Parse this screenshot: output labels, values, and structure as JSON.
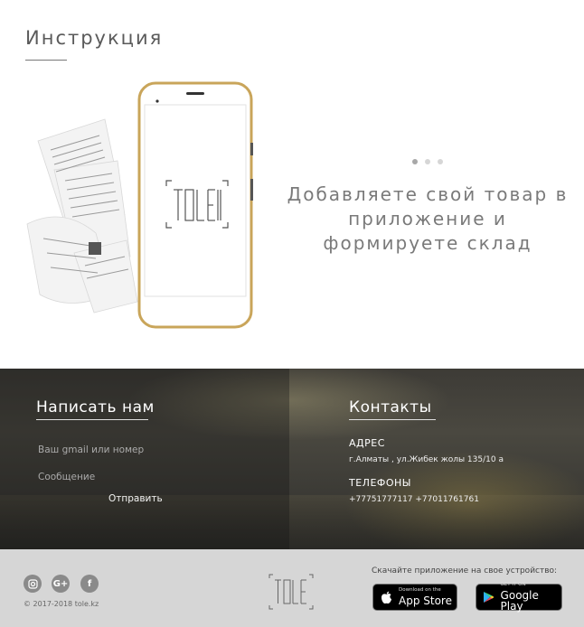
{
  "instructions": {
    "title": "Инструкция",
    "slide_text": "Добавляете свой товар в приложение и формируете склад",
    "dots": {
      "count": 3,
      "active_index": 0
    },
    "logo_text": "TOLE"
  },
  "contact_form": {
    "heading": "Написать нам",
    "email_placeholder": "Ваш gmail или номер",
    "message_placeholder": "Сообщение",
    "send_label": "Отправить"
  },
  "contacts": {
    "heading": "Контакты",
    "address_label": "АДРЕС",
    "address_value": "г.Алматы , ул.Жибек жолы 135/10 а",
    "phones_label": "ТЕЛЕФОНЫ",
    "phones_value": "+77751777117 +77011761761"
  },
  "footer": {
    "social_icons": [
      "instagram-icon",
      "google-plus-icon",
      "facebook-icon"
    ],
    "copyright": "© 2017-2018 tole.kz",
    "logo_text": "TOLE",
    "download_text": "Скачайте приложение на свое устройство:",
    "app_store": {
      "small": "Download on the",
      "big": "App Store"
    },
    "google_play": {
      "small": "GET IT ON",
      "big": "Google Play"
    }
  },
  "colors": {
    "phone_gold": "#c9a55a",
    "dark_band": "#3d3b36",
    "footer_bg": "#d6d6d6"
  }
}
